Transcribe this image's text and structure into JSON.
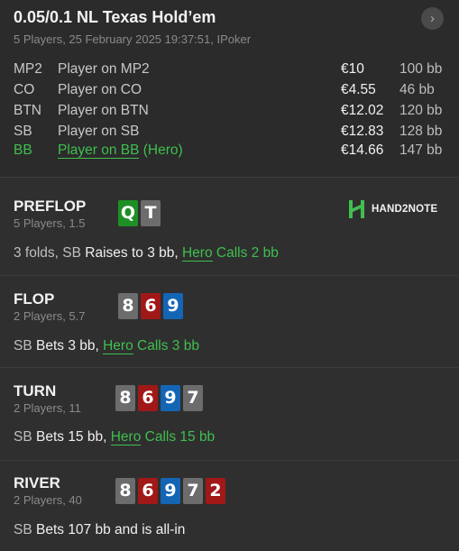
{
  "header": {
    "title": "0.05/0.1 NL Texas Hold’em",
    "subtitle": "5 Players, 25 February 2025 19:37:51, IPoker",
    "next_icon": "chevron-right-icon"
  },
  "players": [
    {
      "pos": "MP2",
      "name": "Player on MP2",
      "hero_suffix": "",
      "stack": "€10",
      "bb": "100 bb"
    },
    {
      "pos": "CO",
      "name": "Player on CO",
      "hero_suffix": "",
      "stack": "€4.55",
      "bb": "46 bb"
    },
    {
      "pos": "BTN",
      "name": "Player on BTN",
      "hero_suffix": "",
      "stack": "€12.02",
      "bb": "120 bb"
    },
    {
      "pos": "SB",
      "name": "Player on SB",
      "hero_suffix": "",
      "stack": "€12.83",
      "bb": "128 bb"
    },
    {
      "pos": "BB",
      "name": "Player on BB",
      "hero_suffix": " (Hero)",
      "stack": "€14.66",
      "bb": "147 bb"
    }
  ],
  "streets": {
    "preflop": {
      "name": "PREFLOP",
      "sub": "5 Players, 1.5",
      "cards": [
        {
          "rank": "Q",
          "suit": "clubs"
        },
        {
          "rank": "T",
          "suit": "spades"
        }
      ],
      "logo": "HAND2NOTE",
      "action": {
        "pre": "3 folds, SB",
        "mid": " Raises to 3 bb, ",
        "hero": "Hero",
        "hero_action": " Calls 2 bb"
      }
    },
    "flop": {
      "name": "FLOP",
      "sub": "2 Players, 5.7",
      "cards": [
        {
          "rank": "8",
          "suit": "spades"
        },
        {
          "rank": "6",
          "suit": "hearts"
        },
        {
          "rank": "9",
          "suit": "diamonds"
        }
      ],
      "action": {
        "pre": "SB",
        "mid": " Bets 3 bb, ",
        "hero": "Hero",
        "hero_action": " Calls 3 bb"
      }
    },
    "turn": {
      "name": "TURN",
      "sub": "2 Players, 11",
      "cards": [
        {
          "rank": "8",
          "suit": "spades"
        },
        {
          "rank": "6",
          "suit": "hearts"
        },
        {
          "rank": "9",
          "suit": "diamonds"
        },
        {
          "rank": "7",
          "suit": "spades"
        }
      ],
      "action": {
        "pre": "SB",
        "mid": " Bets 15 bb, ",
        "hero": "Hero",
        "hero_action": " Calls 15 bb"
      }
    },
    "river": {
      "name": "RIVER",
      "sub": "2 Players, 40",
      "cards": [
        {
          "rank": "8",
          "suit": "spades"
        },
        {
          "rank": "6",
          "suit": "hearts"
        },
        {
          "rank": "9",
          "suit": "diamonds"
        },
        {
          "rank": "7",
          "suit": "spades"
        },
        {
          "rank": "2",
          "suit": "hearts"
        }
      ],
      "action": {
        "pre": "SB",
        "mid": " Bets 107 bb and is all-in",
        "hero": "",
        "hero_action": ""
      }
    }
  },
  "colors": {
    "hero": "#3fbf4f",
    "clubs": "#1e8f25",
    "spades": "#6c6c6c",
    "hearts": "#a01818",
    "diamonds": "#1565b5"
  }
}
